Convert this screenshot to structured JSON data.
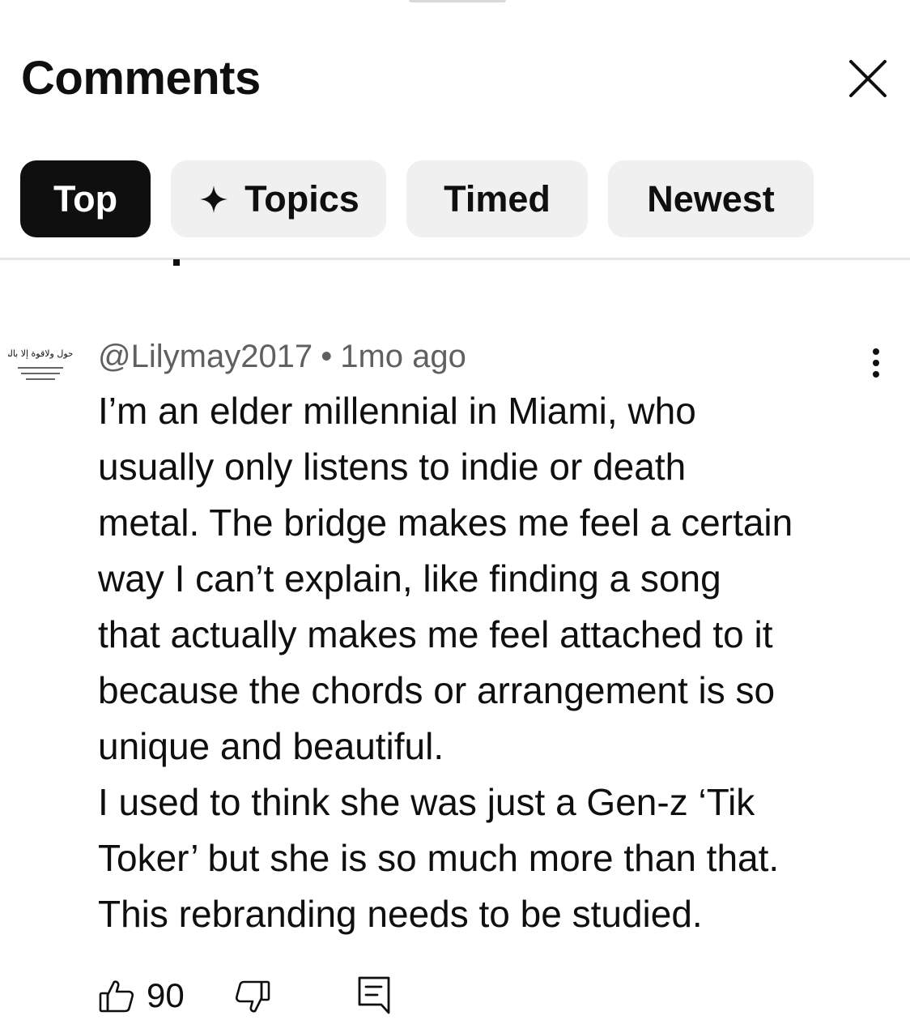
{
  "header": {
    "title": "Comments",
    "close_icon": "close-icon"
  },
  "tabs": [
    {
      "label": "Top",
      "active": true
    },
    {
      "label": "Topics",
      "icon": "sparkle-icon",
      "active": false
    },
    {
      "label": "Timed",
      "active": false
    },
    {
      "label": "Newest",
      "active": false
    }
  ],
  "comment": {
    "author": "@Lilymay2017",
    "separator": "•",
    "time": "1mo ago",
    "avatar_text": "لاحول ولاقوة إلا بالله",
    "lines": [
      "I’m an elder millennial in Miami, who",
      "usually only listens to indie or death",
      "metal. The bridge makes me feel a certain",
      "way I can’t explain, like finding a song",
      "that actually makes me feel attached to it",
      "because the chords or arrangement is so",
      "unique and beautiful.",
      "I used to think she was just a Gen-z ‘Tik",
      "Toker’ but she is so much more than that.",
      "This rebranding needs to be studied."
    ],
    "likes": "90"
  },
  "colors": {
    "active_chip": "#0f0f0f",
    "chip": "#f0f0f0",
    "meta_text": "#606060",
    "divider": "#e5e5e5"
  }
}
